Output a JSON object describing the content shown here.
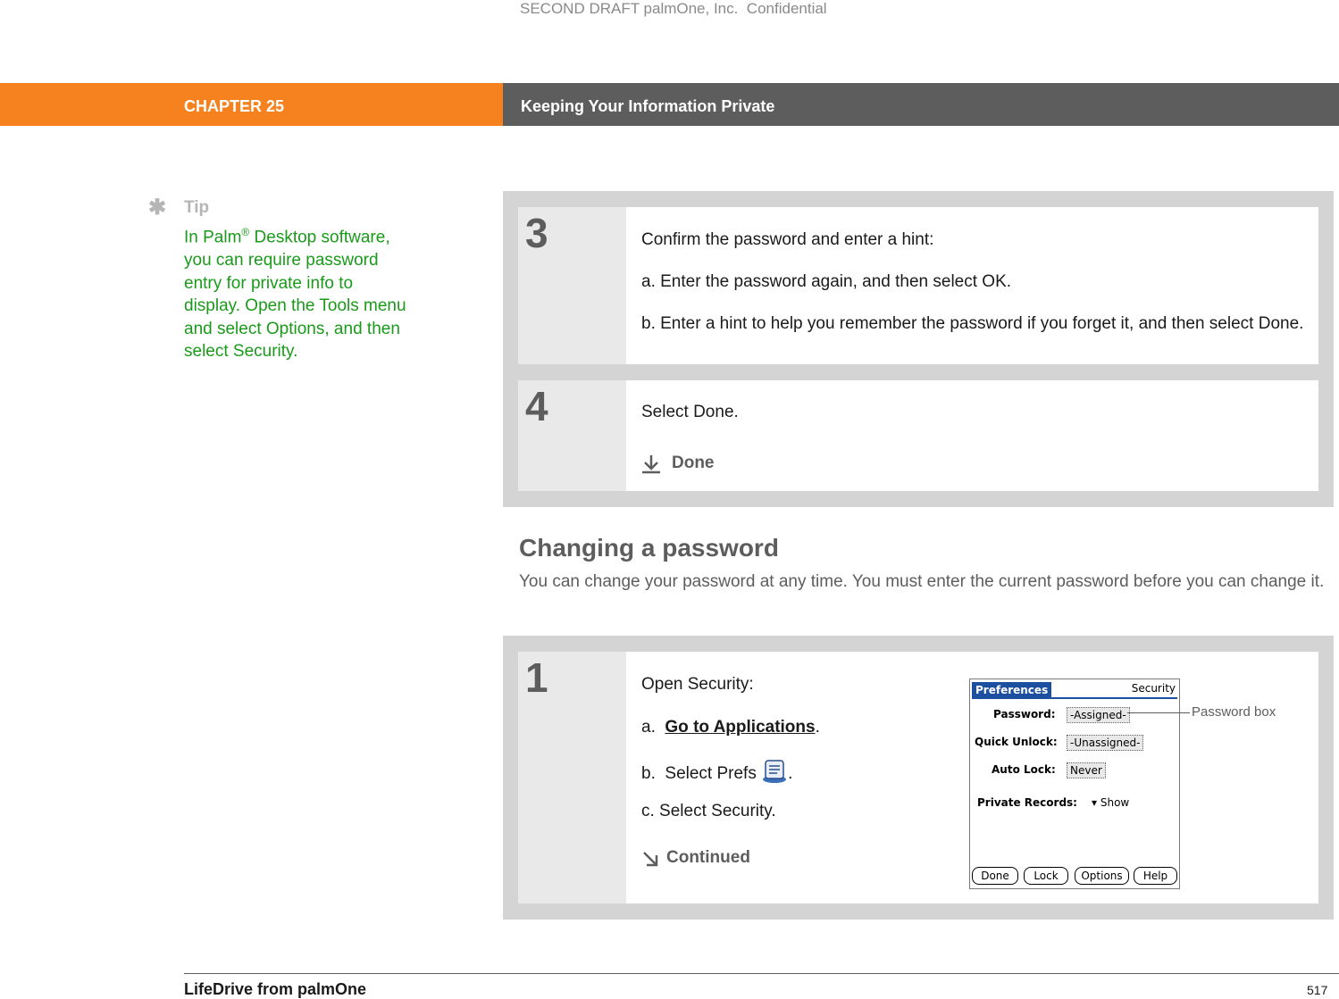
{
  "watermark": "SECOND DRAFT palmOne, Inc.  Confidential",
  "header": {
    "chapter": "CHAPTER 25",
    "title": "Keeping Your Information Private"
  },
  "tip": {
    "icon": "asterisk-icon",
    "heading": "Tip",
    "text_before_reg": "In Palm",
    "reg_mark": "®",
    "text_after_reg": " Desktop software, you can require password entry for private info to display. Open the Tools menu and select Options, and then select Security."
  },
  "steps_top": [
    {
      "number": "3",
      "intro": "Confirm the password and enter a hint:",
      "a": "a.  Enter the password again, and then select OK.",
      "b": "b.  Enter a hint to help you remember the password if you forget it, and then select Done."
    },
    {
      "number": "4",
      "intro": "Select Done.",
      "done_label": "Done",
      "done_icon": "done-arrow-icon"
    }
  ],
  "section": {
    "title": "Changing a password",
    "body": "You can change your password at any time. You must enter the current password before you can change it."
  },
  "step_bottom": {
    "number": "1",
    "intro": "Open Security:",
    "a_prefix": "a.  ",
    "a_link": "Go to Applications",
    "a_suffix": ".",
    "b_prefix": "b.  Select Prefs ",
    "b_suffix": ".",
    "b_icon": "prefs-icon",
    "c": "c.  Select Security.",
    "continued_label": "Continued",
    "continued_icon": "continued-arrow-icon"
  },
  "palm_screen": {
    "title": "Preferences",
    "section": "Security",
    "password_label": "Password:",
    "password_value": "-Assigned-",
    "quick_unlock_label": "Quick Unlock:",
    "quick_unlock_value": "-Unassigned-",
    "auto_lock_label": "Auto Lock:",
    "auto_lock_value": "Never",
    "private_records_label": "Private Records:",
    "private_records_value": "Show",
    "buttons": [
      "Done",
      "Lock",
      "Options",
      "Help"
    ]
  },
  "callout": "Password box",
  "footer": {
    "left": "LifeDrive from palmOne",
    "page": "517"
  }
}
